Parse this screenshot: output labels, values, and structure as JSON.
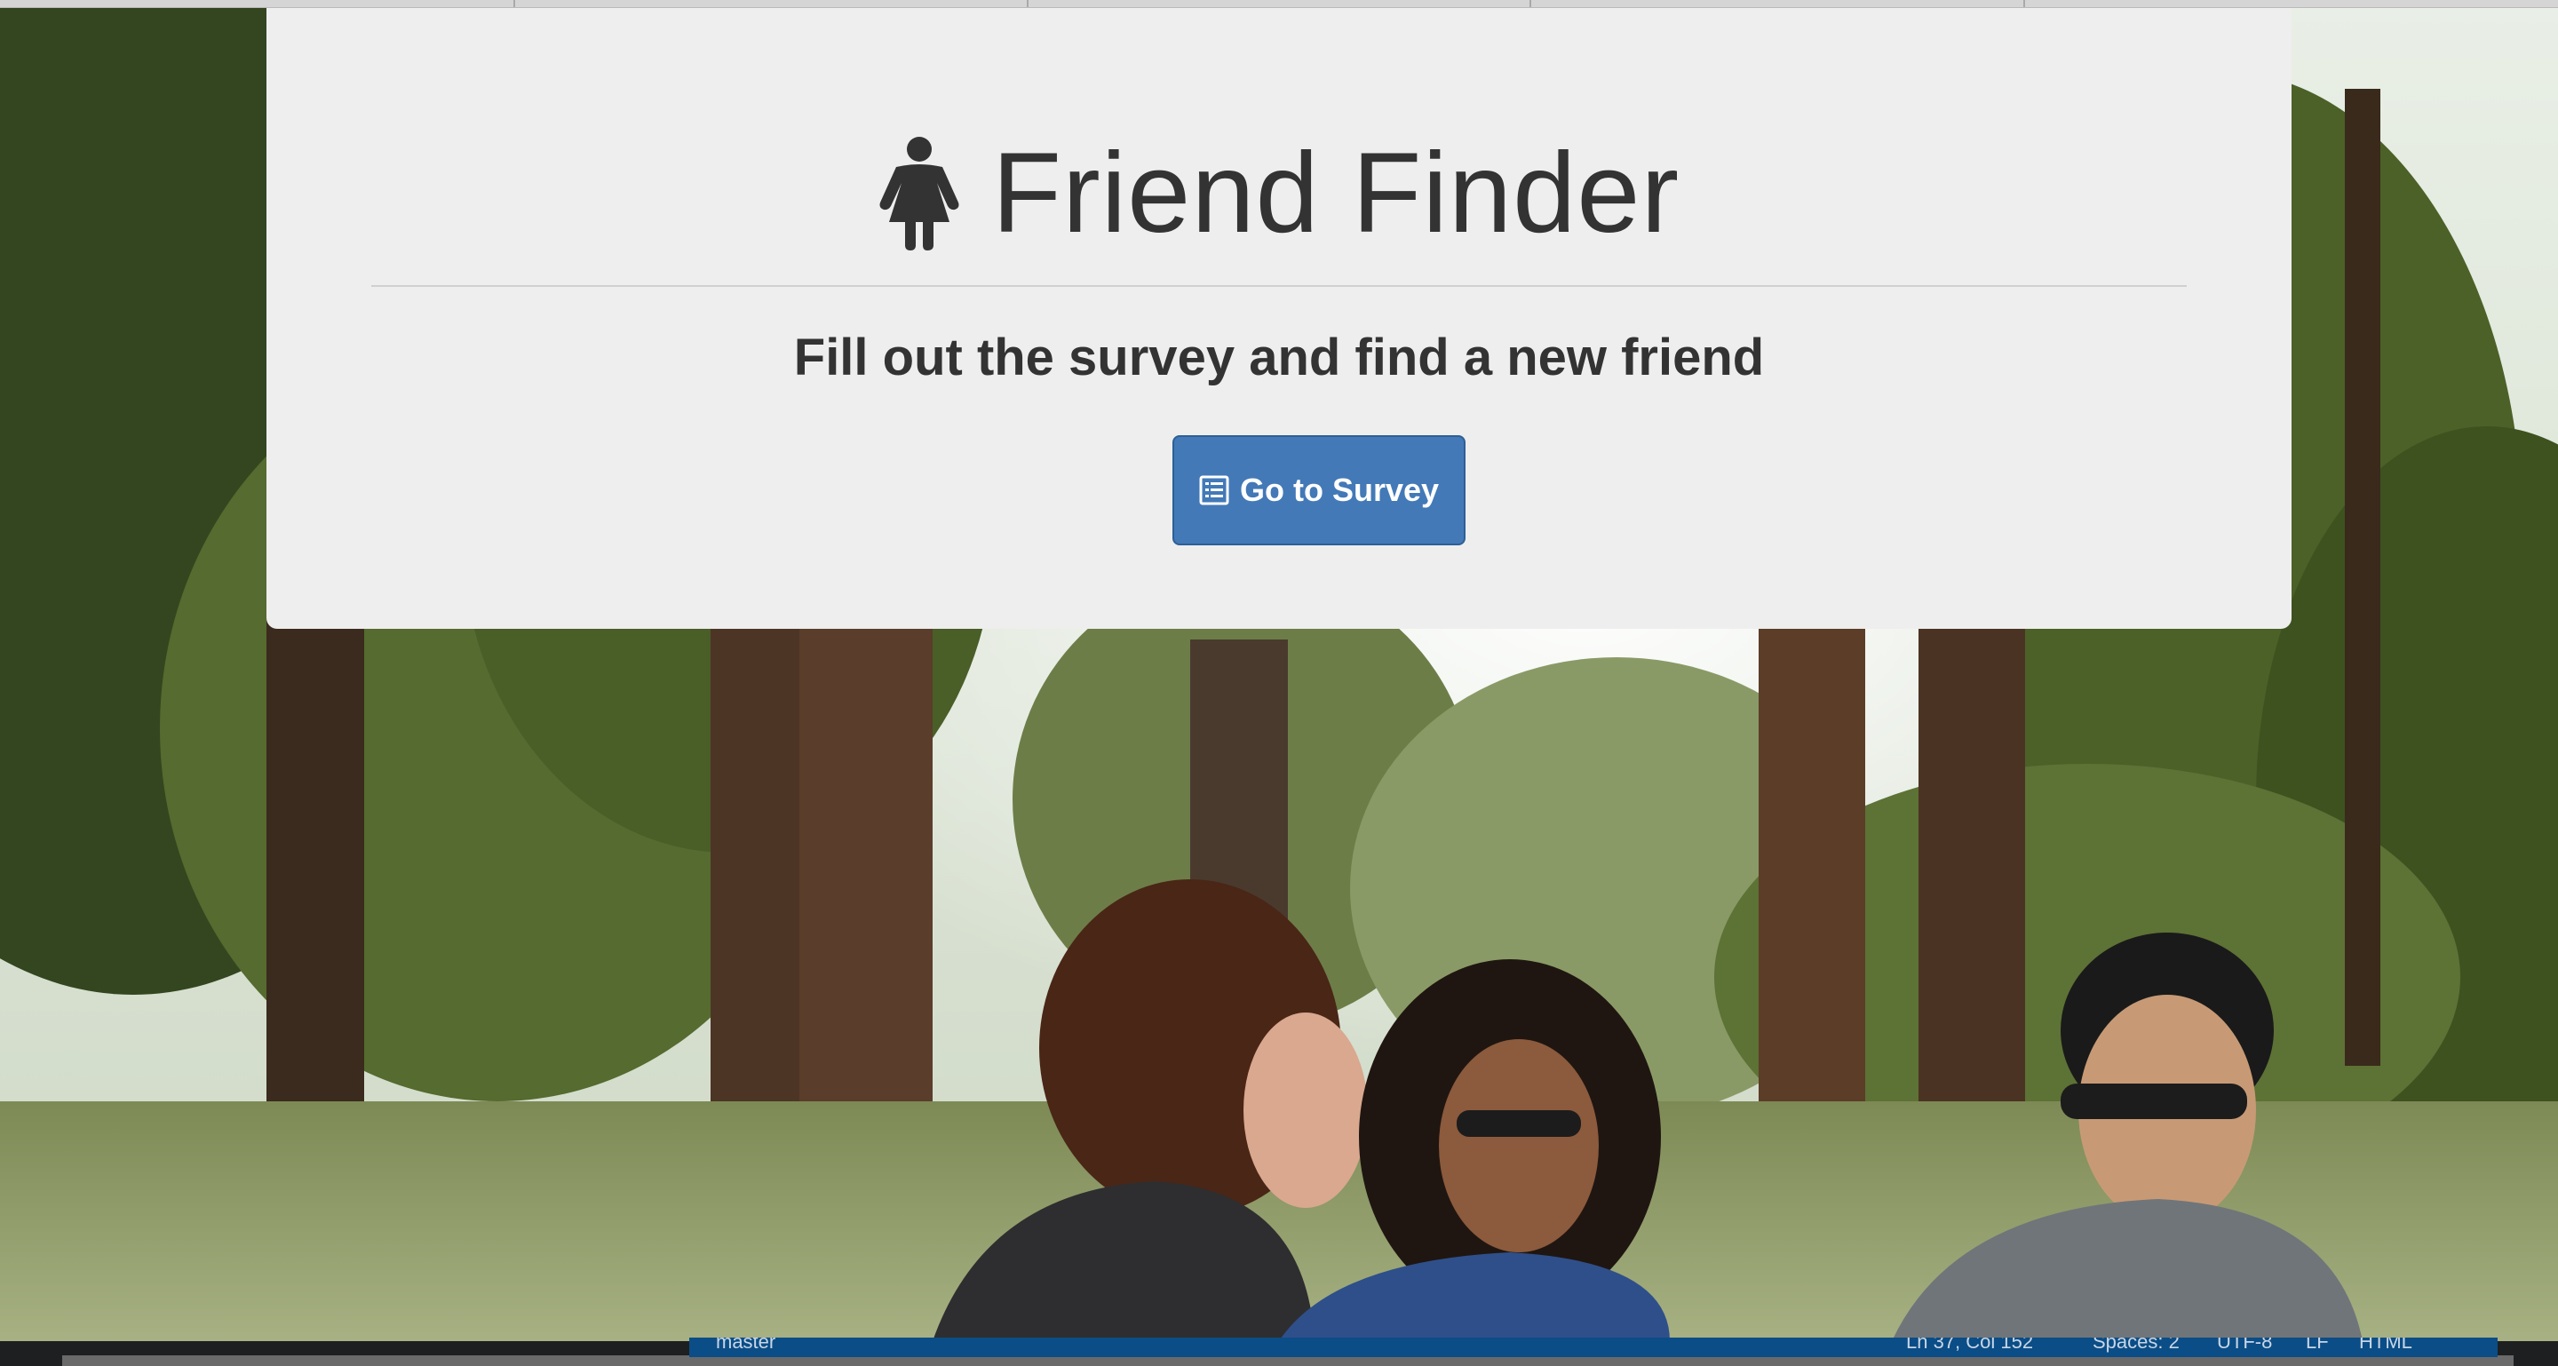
{
  "jumbotron": {
    "title": "Friend Finder",
    "title_icon": "female-icon",
    "subtitle": "Fill out the survey and find a new friend",
    "button_label": "Go to Survey",
    "button_icon": "list-alt-icon"
  },
  "status_bar": {
    "branch": "master",
    "cursor": "Ln 37, Col 152",
    "spaces": "Spaces: 2",
    "encoding": "UTF-8",
    "eol": "LF",
    "language": "HTML"
  },
  "colors": {
    "jumbotron_bg": "#eeeeee",
    "button_bg": "#4379b7",
    "text": "#333333",
    "status_bar_bg": "#0b4d86"
  }
}
